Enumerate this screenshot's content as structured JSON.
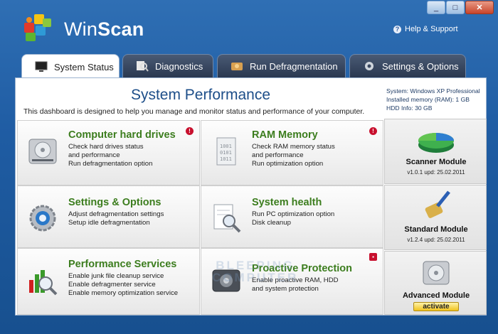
{
  "app": {
    "title_plain": "Win",
    "title_bold": "Scan",
    "help_label": "Help & Support",
    "window_buttons": {
      "minimize": "_",
      "maximize": "□",
      "close": "✕"
    }
  },
  "tabs": [
    {
      "label": "System Status",
      "icon": "monitor-icon",
      "active": true
    },
    {
      "label": "Diagnostics",
      "icon": "magnifier-icon",
      "active": false
    },
    {
      "label": "Run Defragmentation",
      "icon": "defrag-icon",
      "active": false
    },
    {
      "label": "Settings & Options",
      "icon": "gear-icon",
      "active": false
    }
  ],
  "main": {
    "title": "System Performance",
    "description": "This dashboard is designed to help you manage and monitor status and performance of your computer."
  },
  "system_info": {
    "system": "System: Windows XP Professional",
    "memory": "Installed memory (RAM): 1 GB",
    "hdd": "HDD Info: 30 GB"
  },
  "cells": [
    {
      "title": "Computer hard drives",
      "lines": [
        "Check hard drives status",
        "and performance",
        "Run defragmentation option"
      ],
      "icon": "hard-drive-icon",
      "badge": "!"
    },
    {
      "title": "RAM Memory",
      "lines": [
        "Check RAM memory status",
        "and performance",
        "Run optimization option"
      ],
      "icon": "ram-icon",
      "badge": "!"
    },
    {
      "title": "Settings & Options",
      "lines": [
        "Adjust defragmentation settings",
        "Setup idle defragmentation"
      ],
      "icon": "settings-gear-icon"
    },
    {
      "title": "System health",
      "lines": [
        "Run PC optimization option",
        "Disk cleanup"
      ],
      "icon": "document-magnifier-icon"
    },
    {
      "title": "Performance Services",
      "lines": [
        "Enable junk file cleanup service",
        "Enable defragmenter service",
        "Enable memory optimization service"
      ],
      "icon": "chart-magnifier-icon"
    },
    {
      "title": "Proactive Protection",
      "lines": [
        "Enable proactive RAM, HDD",
        "and system protection"
      ],
      "icon": "shield-box-icon",
      "badge": "▪"
    }
  ],
  "modules": [
    {
      "name": "Scanner Module",
      "version": "v1.0.1 upd: 25.02.2011",
      "icon": "pie-chart-icon"
    },
    {
      "name": "Standard Module",
      "version": "v1.2.4 upd: 25.02.2011",
      "icon": "broom-icon"
    },
    {
      "name": "Advanced Module",
      "action": "activate",
      "icon": "disk-icon"
    }
  ],
  "watermark": {
    "line1": "BLEEPING",
    "line2": "COMPUTER"
  },
  "colors": {
    "accent_green": "#3c7d1e",
    "title_blue": "#1d4e89",
    "badge_red": "#c8102e",
    "activate_yellow": "#f0c21d"
  }
}
